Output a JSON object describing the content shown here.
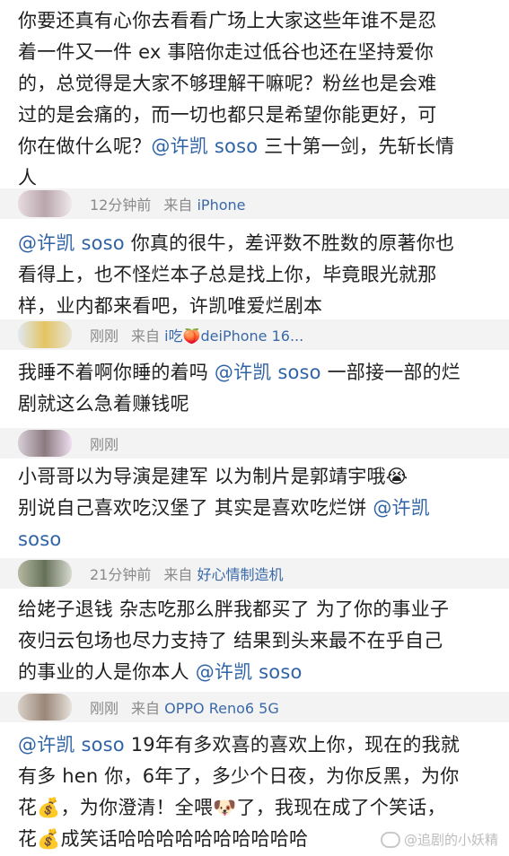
{
  "comments": [
    {
      "lines": [
        "你要还真有心你去看看广场上大家这些年谁不是忍",
        "着一件又一件 ex 事陪你走过低谷也还在坚持爱你",
        "的，总觉得是大家不够理解干嘛呢？粉丝也是会难",
        "过的是会痛的，而一切也都只是希望你能更好，可",
        "你在做什么呢？@许凯 soso 三十第一剑，先斩长情",
        "人"
      ],
      "mention": "@许凯 soso"
    },
    {
      "lines": [
        "@许凯 soso 你真的很牛，差评数不胜数的原著你也",
        "看得上，也不怪烂本子总是找上你，毕竟眼光就那",
        "样，业内都来看吧，许凯唯爱烂剧本"
      ],
      "mention": "@许凯 soso"
    },
    {
      "lines": [
        "我睡不着啊你睡的着吗 @许凯 soso 一部接一部的烂",
        "剧就这么急着赚钱呢"
      ],
      "mention": "@许凯 soso"
    },
    {
      "lines": [
        "小哥哥以为导演是建军 以为制片是郭靖宇哦😭",
        "别说自己喜欢吃汉堡了 其实是喜欢吃烂饼 @许凯",
        "soso"
      ],
      "mention": "@许凯"
    },
    {
      "lines": [
        "给姥子退钱 杂志吃那么胖我都买了 为了你的事业子",
        "夜归云包场也尽力支持了 结果到头来最不在乎自己",
        "的事业的人是你本人 @许凯 soso"
      ],
      "mention": "@许凯 soso"
    },
    {
      "lines": [
        "@许凯 soso 19年有多欢喜的喜欢上你，现在的我就",
        "有多 hen 你，6年了，多少个日夜，为你反黑，为你",
        "花💰，为你澄清！全喂🐶了，我现在成了个笑话，",
        "花💰成笑话哈哈哈哈哈哈哈哈哈哈"
      ],
      "mention": "@许凯 soso"
    }
  ],
  "metas": [
    {
      "time": "12分钟前",
      "source_prefix": "来自",
      "source_device": "iPhone"
    },
    {
      "time": "刚刚",
      "source_prefix": "来自",
      "source_device": "i吃🍑deiPhone 16..."
    },
    {
      "time": "刚刚",
      "source_prefix": "",
      "source_device": ""
    },
    {
      "time": "21分钟前",
      "source_prefix": "来自",
      "source_device": "好心情制造机"
    },
    {
      "time": "刚刚",
      "source_prefix": "来自",
      "source_device": "OPPO Reno6 5G"
    }
  ],
  "watermark": "@追剧的小妖精",
  "colors": {
    "mention": "#2f63a6",
    "meta_bg": "#f3f3f3",
    "meta_text": "#8a8a8a",
    "device": "#3a69a9"
  }
}
